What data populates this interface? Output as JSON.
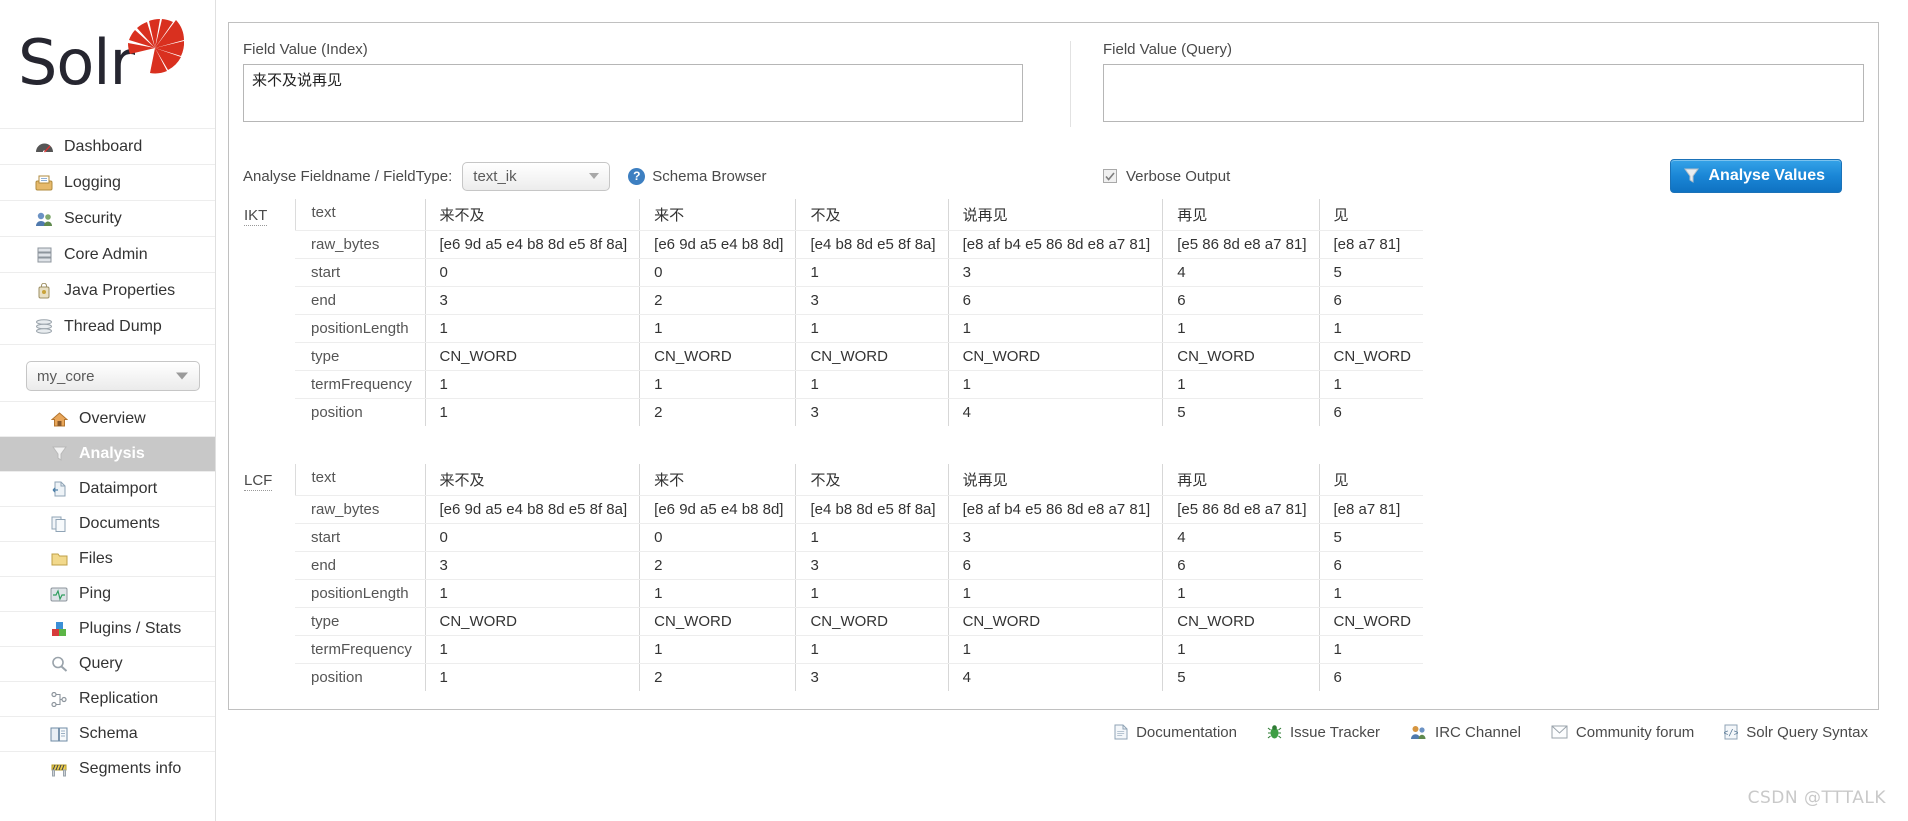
{
  "brand": {
    "name": "Solr",
    "logo_icon": "solr-sunburst-logo"
  },
  "sidebar": {
    "global_items": [
      {
        "label": "Dashboard",
        "icon": "dashboard-gauge-icon"
      },
      {
        "label": "Logging",
        "icon": "logging-tray-icon"
      },
      {
        "label": "Security",
        "icon": "security-users-icon"
      },
      {
        "label": "Core Admin",
        "icon": "core-admin-server-icon"
      },
      {
        "label": "Java Properties",
        "icon": "java-properties-icon"
      },
      {
        "label": "Thread Dump",
        "icon": "thread-dump-stack-icon"
      }
    ],
    "core_selector": {
      "value": "my_core",
      "icon": "chevron-down-icon"
    },
    "core_items": [
      {
        "label": "Overview",
        "icon": "overview-home-icon",
        "active": false
      },
      {
        "label": "Analysis",
        "icon": "analysis-funnel-icon",
        "active": true
      },
      {
        "label": "Dataimport",
        "icon": "dataimport-icon",
        "active": false
      },
      {
        "label": "Documents",
        "icon": "documents-icon",
        "active": false
      },
      {
        "label": "Files",
        "icon": "files-folder-icon",
        "active": false
      },
      {
        "label": "Ping",
        "icon": "ping-monitor-icon",
        "active": false
      },
      {
        "label": "Plugins / Stats",
        "icon": "plugins-blocks-icon",
        "active": false
      },
      {
        "label": "Query",
        "icon": "query-magnifier-icon",
        "active": false
      },
      {
        "label": "Replication",
        "icon": "replication-nodes-icon",
        "active": false
      },
      {
        "label": "Schema",
        "icon": "schema-book-icon",
        "active": false
      },
      {
        "label": "Segments info",
        "icon": "segments-info-icon",
        "active": false
      }
    ]
  },
  "form": {
    "index_label": "Field Value (Index)",
    "index_value": "来不及说再见",
    "index_placeholder": "",
    "query_label": "Field Value (Query)",
    "query_value": "",
    "query_placeholder": "",
    "analyse_label": "Analyse Fieldname / FieldType:",
    "fieldtype_value": "text_ik",
    "schema_browser_label": "Schema Browser",
    "schema_browser_icon": "help-question-icon",
    "verbose_label": "Verbose Output",
    "verbose_checked": true,
    "analyse_button_label": "Analyse Values",
    "analyse_button_icon": "funnel-icon",
    "accent_color": "#1a86d6"
  },
  "analysis": {
    "row_keys": [
      "text",
      "raw_bytes",
      "start",
      "end",
      "positionLength",
      "type",
      "termFrequency",
      "position"
    ],
    "analyzers": [
      {
        "name": "IKT",
        "tokens": [
          {
            "text": "来不及",
            "raw_bytes": "[e6 9d a5 e4 b8 8d e5 8f 8a]",
            "start": "0",
            "end": "3",
            "positionLength": "1",
            "type": "CN_WORD",
            "termFrequency": "1",
            "position": "1"
          },
          {
            "text": "来不",
            "raw_bytes": "[e6 9d a5 e4 b8 8d]",
            "start": "0",
            "end": "2",
            "positionLength": "1",
            "type": "CN_WORD",
            "termFrequency": "1",
            "position": "2"
          },
          {
            "text": "不及",
            "raw_bytes": "[e4 b8 8d e5 8f 8a]",
            "start": "1",
            "end": "3",
            "positionLength": "1",
            "type": "CN_WORD",
            "termFrequency": "1",
            "position": "3"
          },
          {
            "text": "说再见",
            "raw_bytes": "[e8 af b4 e5 86 8d e8 a7 81]",
            "start": "3",
            "end": "6",
            "positionLength": "1",
            "type": "CN_WORD",
            "termFrequency": "1",
            "position": "4"
          },
          {
            "text": "再见",
            "raw_bytes": "[e5 86 8d e8 a7 81]",
            "start": "4",
            "end": "6",
            "positionLength": "1",
            "type": "CN_WORD",
            "termFrequency": "1",
            "position": "5"
          },
          {
            "text": "见",
            "raw_bytes": "[e8 a7 81]",
            "start": "5",
            "end": "6",
            "positionLength": "1",
            "type": "CN_WORD",
            "termFrequency": "1",
            "position": "6"
          }
        ]
      },
      {
        "name": "LCF",
        "tokens": [
          {
            "text": "来不及",
            "raw_bytes": "[e6 9d a5 e4 b8 8d e5 8f 8a]",
            "start": "0",
            "end": "3",
            "positionLength": "1",
            "type": "CN_WORD",
            "termFrequency": "1",
            "position": "1"
          },
          {
            "text": "来不",
            "raw_bytes": "[e6 9d a5 e4 b8 8d]",
            "start": "0",
            "end": "2",
            "positionLength": "1",
            "type": "CN_WORD",
            "termFrequency": "1",
            "position": "2"
          },
          {
            "text": "不及",
            "raw_bytes": "[e4 b8 8d e5 8f 8a]",
            "start": "1",
            "end": "3",
            "positionLength": "1",
            "type": "CN_WORD",
            "termFrequency": "1",
            "position": "3"
          },
          {
            "text": "说再见",
            "raw_bytes": "[e8 af b4 e5 86 8d e8 a7 81]",
            "start": "3",
            "end": "6",
            "positionLength": "1",
            "type": "CN_WORD",
            "termFrequency": "1",
            "position": "4"
          },
          {
            "text": "再见",
            "raw_bytes": "[e5 86 8d e8 a7 81]",
            "start": "4",
            "end": "6",
            "positionLength": "1",
            "type": "CN_WORD",
            "termFrequency": "1",
            "position": "5"
          },
          {
            "text": "见",
            "raw_bytes": "[e8 a7 81]",
            "start": "5",
            "end": "6",
            "positionLength": "1",
            "type": "CN_WORD",
            "termFrequency": "1",
            "position": "6"
          }
        ]
      }
    ]
  },
  "footer": {
    "links": [
      {
        "label": "Documentation",
        "icon": "document-page-icon"
      },
      {
        "label": "Issue Tracker",
        "icon": "bug-icon"
      },
      {
        "label": "IRC Channel",
        "icon": "people-chat-icon"
      },
      {
        "label": "Community forum",
        "icon": "envelope-icon"
      },
      {
        "label": "Solr Query Syntax",
        "icon": "code-page-icon"
      }
    ]
  },
  "watermark": {
    "text": "CSDN @TTTALK"
  }
}
